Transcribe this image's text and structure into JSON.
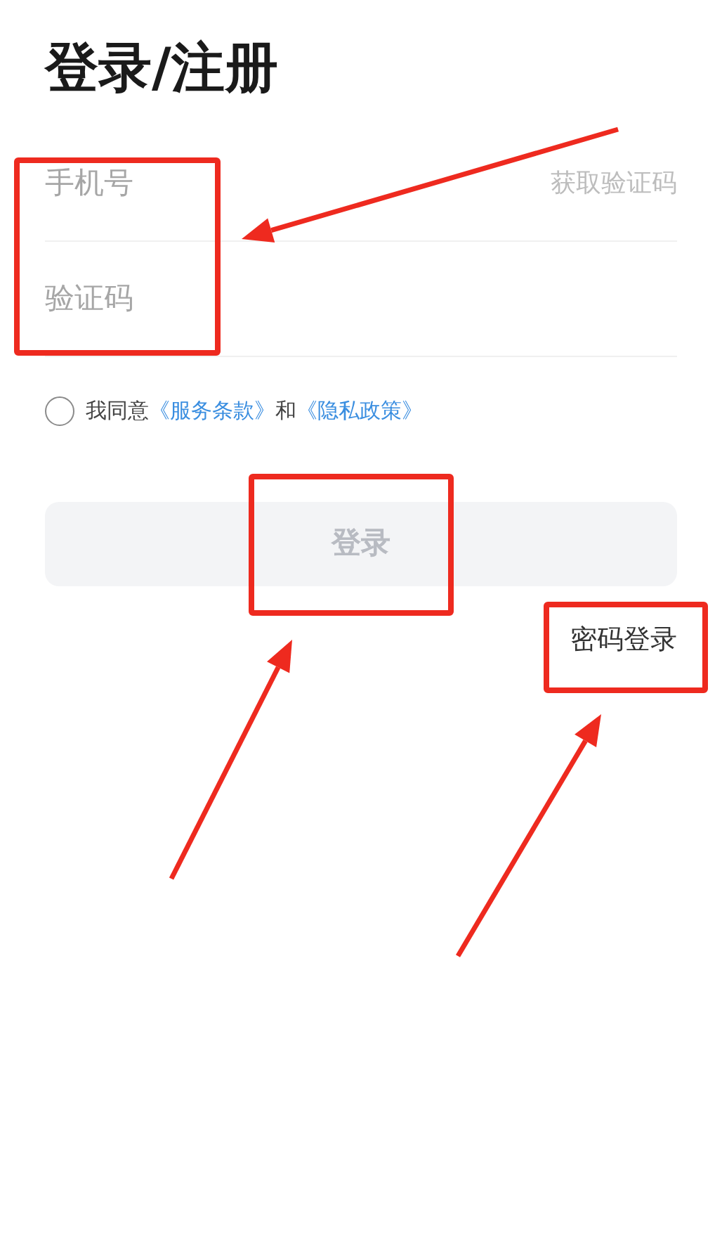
{
  "title": "登录/注册",
  "fields": [
    {
      "placeholder": "手机号",
      "action": "获取验证码"
    },
    {
      "placeholder": "验证码"
    }
  ],
  "agreement": {
    "checked": false,
    "parts": [
      {
        "kind": "text",
        "text": "我同意"
      },
      {
        "kind": "link",
        "text": "《服务条款》"
      },
      {
        "kind": "text",
        "text": "和"
      },
      {
        "kind": "link",
        "text": "《隐私政策》"
      }
    ]
  },
  "login_button": {
    "label": "登录",
    "disabled": true
  },
  "alt_login": "密码登录"
}
